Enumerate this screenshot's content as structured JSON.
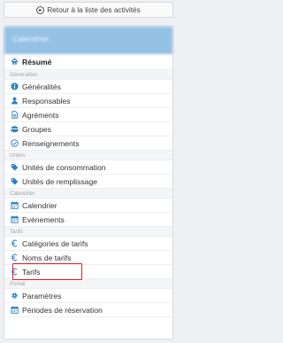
{
  "back_button": {
    "label": "Retour à la liste des activités",
    "icon": "circle-arrow-left-icon"
  },
  "panel": {
    "title": "Calendrier"
  },
  "summary": {
    "label": "Résumé",
    "icon": "home-icon"
  },
  "sections": {
    "generalites": "Généralités",
    "unites": "Unités",
    "calendrier": "Calendrier",
    "tarifs": "Tarifs",
    "portail": "Portail"
  },
  "items": {
    "generalites": "Généralités",
    "responsables": "Responsables",
    "agrements": "Agréments",
    "groupes": "Groupes",
    "renseignements": "Renseignements",
    "unites_consommation": "Unités de consommation",
    "unites_remplissage": "Unités de remplissage",
    "calendrier": "Calendrier",
    "evenements": "Evénements",
    "categories_tarifs": "Catégories de tarifs",
    "noms_tarifs": "Noms de tarifs",
    "tarifs": "Tarifs",
    "parametres": "Paramètres",
    "periodes_reservation": "Périodes de réservation"
  },
  "colors": {
    "accent": "#3d8fcf",
    "icon": "#2f7fc1",
    "highlight": "#d6242c"
  }
}
